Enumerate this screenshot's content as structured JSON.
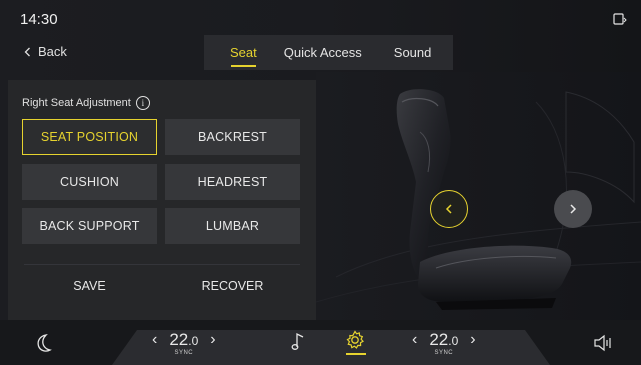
{
  "status": {
    "time": "14:30"
  },
  "nav": {
    "back_label": "Back"
  },
  "tabs": [
    {
      "label": "Seat",
      "active": true
    },
    {
      "label": "Quick Access",
      "active": false
    },
    {
      "label": "Sound",
      "active": false
    }
  ],
  "panel": {
    "title": "Right Seat Adjustment",
    "info_icon": "i",
    "buttons": [
      "SEAT POSITION",
      "BACKREST",
      "CUSHION",
      "HEADREST",
      "BACK SUPPORT",
      "LUMBAR"
    ],
    "selected": "SEAT POSITION",
    "save_label": "SAVE",
    "recover_label": "RECOVER"
  },
  "climate": {
    "left": {
      "whole": "22",
      "decimal": ".0",
      "sync_label": "SYNC"
    },
    "right": {
      "whole": "22",
      "decimal": ".0",
      "sync_label": "SYNC"
    }
  },
  "colors": {
    "accent": "#e6d32f",
    "panel": "#262729",
    "button": "#36373a",
    "background": "#1c1d21"
  },
  "icons": [
    "phone-icon",
    "back-chevron-icon",
    "info-icon",
    "seat-image",
    "chevron-left-icon",
    "chevron-right-icon",
    "moon-icon",
    "music-note-icon",
    "settings-gear-icon",
    "volume-icon"
  ]
}
